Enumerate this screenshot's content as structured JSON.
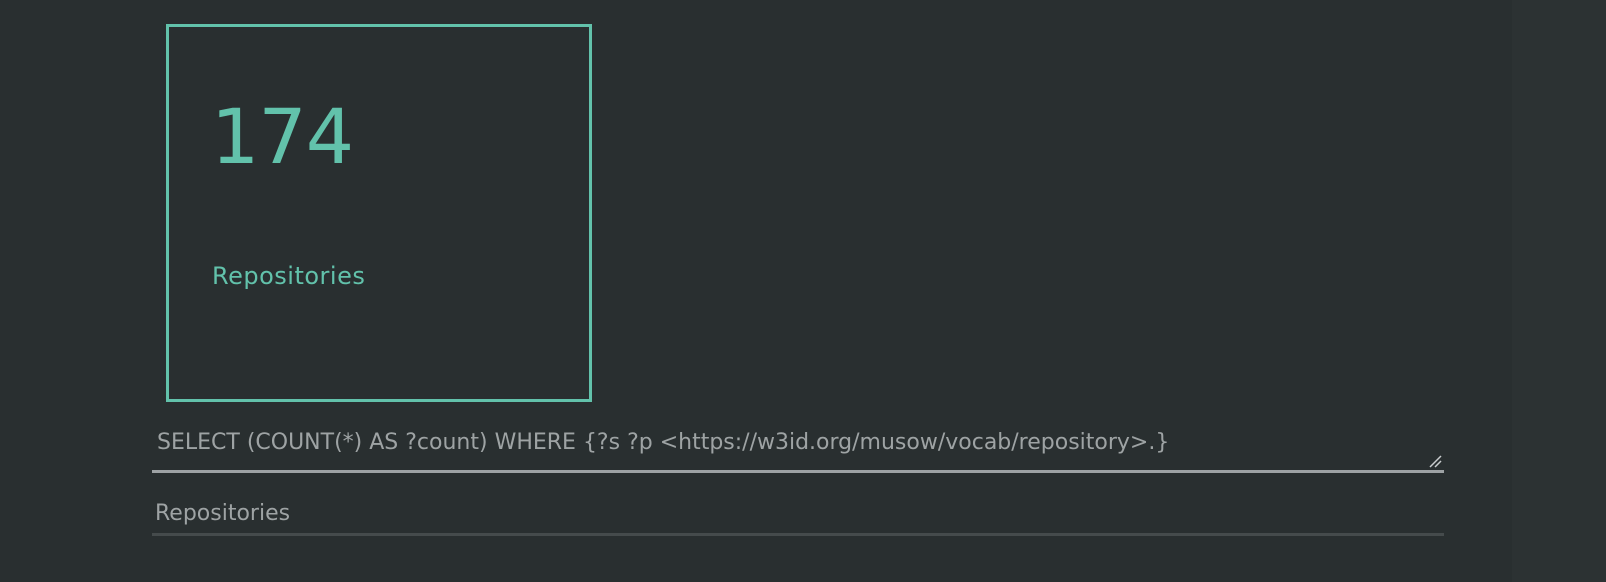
{
  "card": {
    "value": "174",
    "label": "Repositories"
  },
  "query_field": {
    "value": "SELECT (COUNT(*) AS ?count) WHERE {?s ?p <https://w3id.org/musow/vocab/repository>.}"
  },
  "label_field": {
    "value": "Repositories"
  },
  "colors": {
    "background": "#292f30",
    "accent": "#62c2ab",
    "text_muted": "#9ea3a4",
    "underline_active": "#9da2a4",
    "underline_inactive": "#454b4c"
  },
  "icons": {
    "resize": "resize-handle-icon"
  }
}
